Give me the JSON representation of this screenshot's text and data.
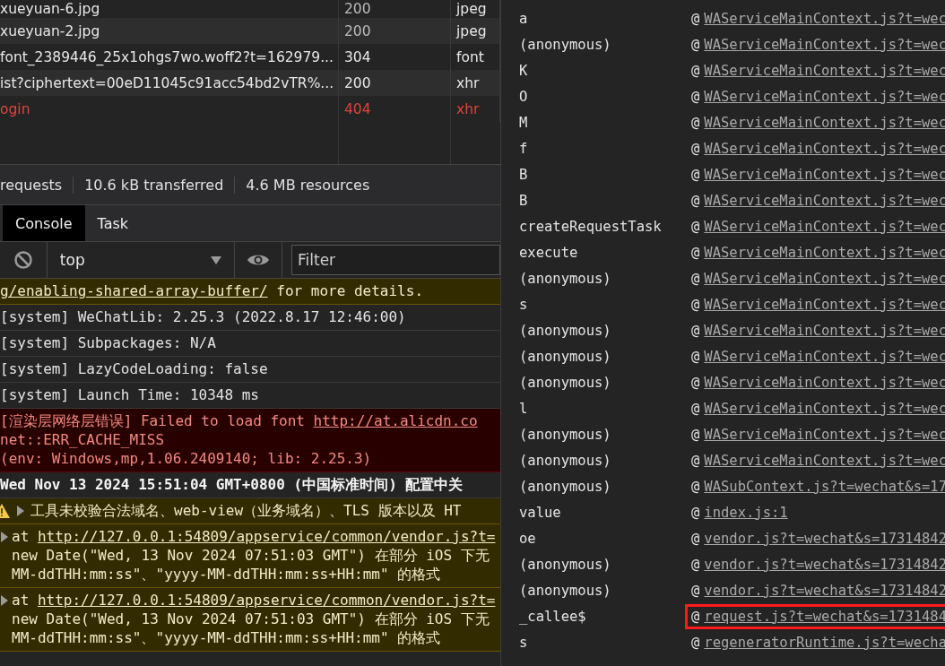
{
  "network": {
    "rows": [
      {
        "name": "xueyuan-6.jpg",
        "status": "200",
        "type": "jpeg",
        "failed": false
      },
      {
        "name": "xueyuan-2.jpg",
        "status": "200",
        "type": "jpeg",
        "failed": false
      },
      {
        "name": "font_2389446_25x1ohgs7wo.woff2?t=162979...",
        "status": "304",
        "type": "font",
        "failed": false
      },
      {
        "name": "ist?ciphertext=00eD11045c91acc54bd2vTR%...",
        "status": "200",
        "type": "xhr",
        "failed": false
      },
      {
        "name": "ogin",
        "status": "404",
        "type": "xhr",
        "failed": true
      }
    ],
    "summary": [
      "requests",
      "10.6 kB transferred",
      "4.6 MB resources"
    ]
  },
  "drawer_tabs": [
    {
      "label": "Console",
      "selected": true
    },
    {
      "label": "Task",
      "selected": false
    }
  ],
  "console_toolbar": {
    "context": "top",
    "filter": {
      "placeholder": "Filter"
    }
  },
  "messages": [
    {
      "kind": "warning",
      "lines": [
        [
          {
            "text": "g/enabling-shared-array-buffer/",
            "link": true
          },
          {
            "text": " for more details.",
            "link": false
          }
        ]
      ]
    },
    {
      "kind": "info",
      "lines": [
        [
          {
            "text": "[system] WeChatLib: 2.25.3 (2022.8.17 12:46:00)",
            "link": false
          }
        ]
      ]
    },
    {
      "kind": "info",
      "lines": [
        [
          {
            "text": "[system] Subpackages: N/A",
            "link": false
          }
        ]
      ]
    },
    {
      "kind": "info",
      "lines": [
        [
          {
            "text": "[system] LazyCodeLoading: false",
            "link": false
          }
        ]
      ]
    },
    {
      "kind": "info",
      "lines": [
        [
          {
            "text": "[system] Launch Time: 10348 ms",
            "link": false
          }
        ]
      ]
    },
    {
      "kind": "error",
      "lines": [
        [
          {
            "text": "[渲染层网络层错误] Failed to load font ",
            "link": false
          },
          {
            "text": "http://at.alicdn.co",
            "link": true
          }
        ],
        [
          {
            "text": "net::ERR_CACHE_MISS",
            "link": false
          }
        ],
        [
          {
            "text": "(env: Windows,mp,1.06.2409140; lib: 2.25.3)",
            "link": false
          }
        ]
      ]
    },
    {
      "kind": "heading",
      "lines": [
        [
          {
            "text": "Wed Nov 13 2024 15:51:04 GMT+0800 (中国标准时间) 配置中关",
            "link": false
          }
        ]
      ]
    },
    {
      "kind": "warning",
      "icon": true,
      "expander": true,
      "lines": [
        [
          {
            "text": "工具未校验合法域名、web-view（业务域名）、TLS 版本以及 HT",
            "link": false
          }
        ]
      ]
    },
    {
      "kind": "warning",
      "expander": true,
      "lines": [
        [
          {
            "text": "at ",
            "link": false
          },
          {
            "text": "http://127.0.0.1:54809/appservice/common/vendor.js?t=",
            "link": true
          }
        ],
        [
          {
            "text": "new Date(\"Wed, 13 Nov 2024 07:51:03 GMT\") 在部分 iOS 下无",
            "link": false
          }
        ],
        [
          {
            "text": "MM-ddTHH:mm:ss\"、\"yyyy-MM-ddTHH:mm:ss+HH:mm\" 的格式",
            "link": false
          }
        ]
      ]
    },
    {
      "kind": "warning",
      "expander": true,
      "lines": [
        [
          {
            "text": "at ",
            "link": false
          },
          {
            "text": "http://127.0.0.1:54809/appservice/common/vendor.js?t=",
            "link": true
          }
        ],
        [
          {
            "text": "new Date(\"Wed, 13 Nov 2024 07:51:03 GMT\") 在部分 iOS 下无",
            "link": false
          }
        ],
        [
          {
            "text": "MM-ddTHH:mm:ss\"、\"yyyy-MM-ddTHH:mm:ss+HH:mm\" 的格式",
            "link": false
          }
        ]
      ]
    }
  ],
  "stack": {
    "at": "@",
    "frames": [
      {
        "function": "a",
        "source": "WAServiceMainContext.js?t=wec",
        "highlighted": false
      },
      {
        "function": "(anonymous)",
        "source": "WAServiceMainContext.js?t=wec",
        "highlighted": false
      },
      {
        "function": "K",
        "source": "WAServiceMainContext.js?t=wec",
        "highlighted": false
      },
      {
        "function": "O",
        "source": "WAServiceMainContext.js?t=wec",
        "highlighted": false
      },
      {
        "function": "M",
        "source": "WAServiceMainContext.js?t=wec",
        "highlighted": false
      },
      {
        "function": "f",
        "source": "WAServiceMainContext.js?t=wec",
        "highlighted": false
      },
      {
        "function": "B",
        "source": "WAServiceMainContext.js?t=wec",
        "highlighted": false
      },
      {
        "function": "B",
        "source": "WAServiceMainContext.js?t=wec",
        "highlighted": false
      },
      {
        "function": "createRequestTask",
        "source": "WAServiceMainContext.js?t=wec",
        "highlighted": false
      },
      {
        "function": "execute",
        "source": "WAServiceMainContext.js?t=wec",
        "highlighted": false
      },
      {
        "function": "(anonymous)",
        "source": "WAServiceMainContext.js?t=wec",
        "highlighted": false
      },
      {
        "function": "s",
        "source": "WAServiceMainContext.js?t=wec",
        "highlighted": false
      },
      {
        "function": "(anonymous)",
        "source": "WAServiceMainContext.js?t=wec",
        "highlighted": false
      },
      {
        "function": "(anonymous)",
        "source": "WAServiceMainContext.js?t=wec",
        "highlighted": false
      },
      {
        "function": "(anonymous)",
        "source": "WAServiceMainContext.js?t=wec",
        "highlighted": false
      },
      {
        "function": "l",
        "source": "WAServiceMainContext.js?t=wec",
        "highlighted": false
      },
      {
        "function": "(anonymous)",
        "source": "WAServiceMainContext.js?t=wec",
        "highlighted": false
      },
      {
        "function": "(anonymous)",
        "source": "WAServiceMainContext.js?t=wec",
        "highlighted": false
      },
      {
        "function": "(anonymous)",
        "source": "WASubContext.js?t=wechat&s=17",
        "highlighted": false
      },
      {
        "function": "value",
        "source": "index.js:1",
        "highlighted": false
      },
      {
        "function": "oe",
        "source": "vendor.js?t=wechat&s=17314842",
        "highlighted": false
      },
      {
        "function": "(anonymous)",
        "source": "vendor.js?t=wechat&s=17314842",
        "highlighted": false
      },
      {
        "function": "(anonymous)",
        "source": "vendor.js?t=wechat&s=17314842",
        "highlighted": false
      },
      {
        "function": "_callee$",
        "source": "request.js?t=wechat&s=1731484",
        "highlighted": true
      },
      {
        "function": "s",
        "source": "regeneratorRuntime.js?t=wecha",
        "highlighted": false
      }
    ]
  }
}
